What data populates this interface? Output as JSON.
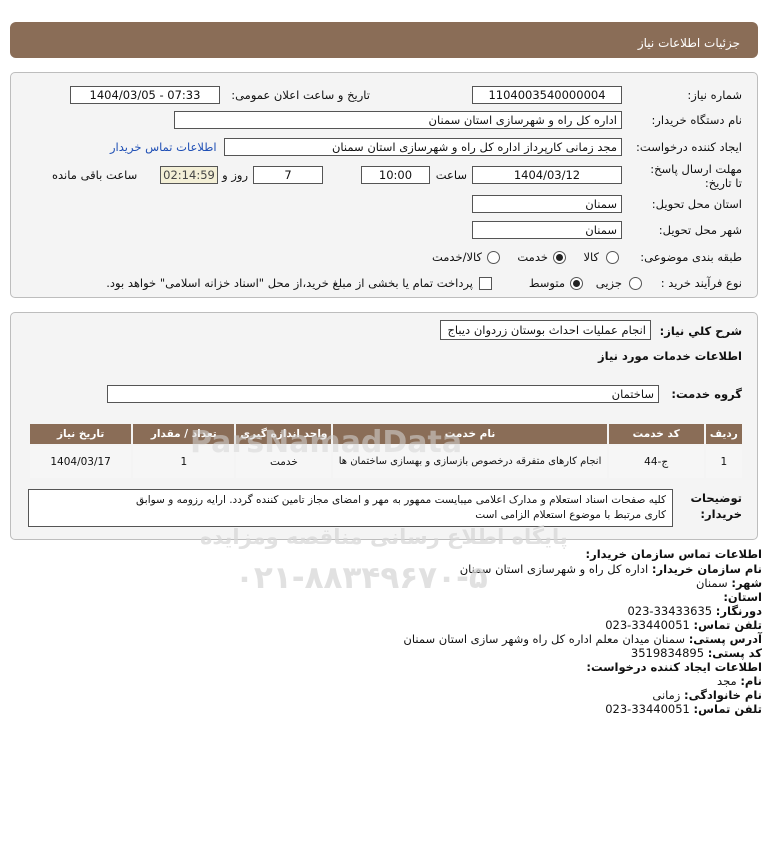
{
  "header": {
    "title": "جزئیات اطلاعات نیاز"
  },
  "form": {
    "need_number_label": "شماره نیاز:",
    "need_number": "1104003540000004",
    "announce_label": "تاریخ و ساعت اعلان عمومی:",
    "announce_value": "1404/03/05 - 07:33",
    "buyer_label": "نام دستگاه خریدار:",
    "buyer_value": "اداره کل راه و شهرسازی استان سمنان",
    "creator_label": "ایجاد کننده درخواست:",
    "creator_value": "مجد زمانی کارپرداز اداره کل راه و شهرسازی استان سمنان",
    "contact_link": "اطلاعات تماس خریدار",
    "deadline_label": "مهلت ارسال پاسخ: تا تاریخ:",
    "deadline_date": "1404/03/12",
    "hour_label": "ساعت",
    "deadline_time": "10:00",
    "days_value": "7",
    "days_label": "روز و",
    "remaining_time": "02:14:59",
    "remaining_label": "ساعت باقی مانده",
    "province_label": "استان محل تحویل:",
    "province_value": "سمنان",
    "city_label": "شهر محل تحویل:",
    "city_value": "سمنان",
    "category_label": "طبقه بندی موضوعی:",
    "category_options": [
      "کالا",
      "خدمت",
      "کالا/خدمت"
    ],
    "category_selected": "خدمت",
    "process_label": "نوع فرآیند خرید :",
    "process_options": [
      "جزیی",
      "متوسط"
    ],
    "process_selected": "متوسط",
    "payment_note": "پرداخت تمام یا بخشی از مبلغ خرید،از محل \"اسناد خزانه اسلامی\" خواهد بود."
  },
  "details": {
    "summary_label": "شرح کلي نياز:",
    "summary_value": "انجام عملیات احداث بوستان زردوان دیباج",
    "services_title": "اطلاعات خدمات مورد نیاز",
    "service_group_label": "گروه خدمت:",
    "service_group_value": "ساختمان",
    "table_headers": [
      "ردیف",
      "کد خدمت",
      "نام خدمت",
      "واحد اندازه گیری",
      "تعداد / مقدار",
      "تاریخ نیاز"
    ],
    "table_rows": [
      {
        "row": "1",
        "code": "ج-44",
        "name": "انجام کارهای متفرقه درخصوص بازسازی و بهسازی ساختمان ها",
        "unit": "خدمت",
        "qty": "1",
        "date": "1404/03/17"
      }
    ],
    "buyer_notes_label": "توضیحات خریدار:",
    "buyer_notes_line1": "کلیه صفحات اسناد استعلام و مدارک اعلامی میبایست ممهور به مهر و امضای مجاز تامین کننده گردد. ارایه رزومه و سوابق",
    "buyer_notes_line2": "کاری مرتبط با موضوع استعلام الزامی است"
  },
  "contact": {
    "org_title": "اطلاعات تماس سازمان خریدار:",
    "org_name_label": "نام سازمان خریدار:",
    "org_name": "اداره کل راه و شهرسازی استان سمنان",
    "city_label": "شهر:",
    "city": "سمنان",
    "province_label": "استان:",
    "province": "",
    "fax_label": "دورنگار:",
    "fax": "023-33433635",
    "phone_label": "تلفن تماس:",
    "phone": "023-33440051",
    "address_label": "آدرس پستی:",
    "address": "سمنان میدان معلم اداره کل راه وشهر سازی استان سمنان",
    "postal_label": "کد پستی:",
    "postal": "3519834895",
    "creator_title": "اطلاعات ایجاد کننده درخواست:",
    "first_name_label": "نام:",
    "first_name": "مجد",
    "last_name_label": "نام خانوادگی:",
    "last_name": "زمانی",
    "creator_phone_label": "تلفن تماس:",
    "creator_phone": "023-33440051"
  },
  "watermark": {
    "site": "ParsNamadData",
    "portal": "پایگاه اطلاع رسانی مناقصه ومزایده",
    "phone": "۰۲۱-۸۸۳۴۹۶۷۰-۵"
  }
}
